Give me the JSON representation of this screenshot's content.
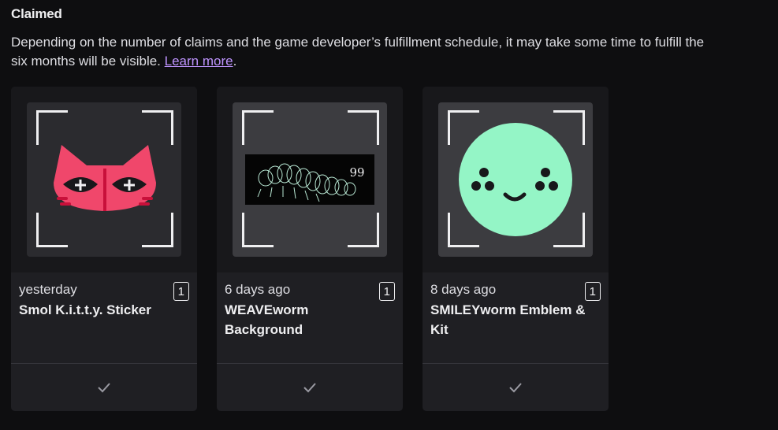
{
  "section": {
    "title": "Claimed",
    "description": "Depending on the number of claims and the game developer’s fulfillment schedule, it may take some time to fulfill the",
    "description_line2": "six months will be visible.",
    "learn_more": "Learn more",
    "trailing": "."
  },
  "cards": [
    {
      "time": "yesterday",
      "count": "1",
      "title": "Smol K.i.t.t.y. Sticker",
      "art": "cat-sticker-icon"
    },
    {
      "time": "6 days ago",
      "count": "1",
      "title": "WEAVEworm Background",
      "art": "worm-banner-image",
      "banner_number": "99"
    },
    {
      "time": "8 days ago",
      "count": "1",
      "title": "SMILEYworm Emblem & Kit",
      "art": "smiley-face-icon"
    }
  ],
  "colors": {
    "background": "#0e0e10",
    "card": "#1f1f23",
    "link": "#bf94ff",
    "cat": "#f0476b",
    "smiley": "#94f5c6"
  }
}
